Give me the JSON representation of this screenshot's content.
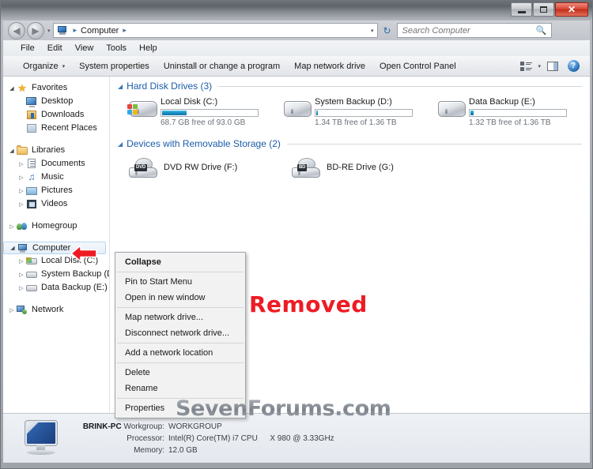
{
  "window": {
    "title": "Computer",
    "buttons": {
      "minimize": "minimize-button",
      "maximize": "maximize-button",
      "close": "✕"
    }
  },
  "address": {
    "crumb_root": "Computer",
    "separator": "▸",
    "dropdown_caret": "▾",
    "refresh_icon": "↻"
  },
  "search": {
    "placeholder": "Search Computer",
    "value": "",
    "icon": "search-icon"
  },
  "menubar": {
    "items": [
      "File",
      "Edit",
      "View",
      "Tools",
      "Help"
    ]
  },
  "toolbar": {
    "organize": "Organize",
    "organize_caret": "▾",
    "items": [
      "System properties",
      "Uninstall or change a program",
      "Map network drive",
      "Open Control Panel"
    ],
    "view_caret": "▾",
    "help_glyph": "?"
  },
  "sidebar": {
    "groups": [
      {
        "label": "Favorites",
        "icon": "star-icon",
        "twisty": "◢",
        "children": [
          {
            "label": "Desktop",
            "icon": "desktop-icon",
            "twisty": ""
          },
          {
            "label": "Downloads",
            "icon": "downloads-icon",
            "twisty": ""
          },
          {
            "label": "Recent Places",
            "icon": "recent-places-icon",
            "twisty": ""
          }
        ]
      },
      {
        "label": "Libraries",
        "icon": "libraries-folder-icon",
        "twisty": "◢",
        "children": [
          {
            "label": "Documents",
            "icon": "documents-icon",
            "twisty": "▷"
          },
          {
            "label": "Music",
            "icon": "music-icon",
            "twisty": "▷"
          },
          {
            "label": "Pictures",
            "icon": "pictures-icon",
            "twisty": "▷"
          },
          {
            "label": "Videos",
            "icon": "videos-icon",
            "twisty": "▷"
          }
        ]
      },
      {
        "label": "Homegroup",
        "icon": "homegroup-icon",
        "twisty": "▷",
        "children": []
      },
      {
        "label": "Computer",
        "icon": "computer-icon",
        "twisty": "◢",
        "selected": true,
        "children": [
          {
            "label": "Local Disk (C:)",
            "icon": "local-disk-icon",
            "twisty": "▷"
          },
          {
            "label": "System Backup (D:)",
            "icon": "hard-disk-icon",
            "twisty": "▷"
          },
          {
            "label": "Data Backup (E:)",
            "icon": "hard-disk-icon",
            "twisty": "▷"
          }
        ]
      },
      {
        "label": "Network",
        "icon": "network-icon",
        "twisty": "▷",
        "children": []
      }
    ]
  },
  "content": {
    "group_hard_disks": {
      "label": "Hard Disk Drives (3)",
      "twisty": "◢",
      "drives": [
        {
          "name": "Local Disk (C:)",
          "free_text": "68.7 GB free of 93.0 GB",
          "used_percent": 26,
          "icon": "windows-drive-icon"
        },
        {
          "name": "System Backup (D:)",
          "free_text": "1.34 TB free of 1.36 TB",
          "used_percent": 2,
          "icon": "hard-drive-icon"
        },
        {
          "name": "Data Backup (E:)",
          "free_text": "1.32 TB free of 1.36 TB",
          "used_percent": 3,
          "icon": "hard-drive-icon"
        }
      ]
    },
    "group_removable": {
      "label": "Devices with Removable Storage (2)",
      "twisty": "◢",
      "devices": [
        {
          "name": "DVD RW Drive (F:)",
          "badge": "DVD",
          "icon": "optical-drive-icon"
        },
        {
          "name": "BD-RE Drive (G:)",
          "badge": "BD",
          "icon": "optical-drive-icon"
        }
      ]
    },
    "annotation": {
      "removed_label": "Removed",
      "removed_color": "#ee1b24"
    },
    "watermark": "SevenForums.com"
  },
  "context_menu": {
    "sections": [
      [
        {
          "label": "Collapse",
          "bold": true
        }
      ],
      [
        {
          "label": "Pin to Start Menu"
        },
        {
          "label": "Open in new window"
        }
      ],
      [
        {
          "label": "Map network drive..."
        },
        {
          "label": "Disconnect network drive..."
        }
      ],
      [
        {
          "label": "Add a network location"
        }
      ],
      [
        {
          "label": "Delete"
        },
        {
          "label": "Rename"
        }
      ],
      [
        {
          "label": "Properties"
        }
      ]
    ]
  },
  "details_pane": {
    "computer_name": "BRINK-PC",
    "rows": [
      {
        "key": "Workgroup:",
        "value": "WORKGROUP"
      },
      {
        "key": "Processor:",
        "value": "Intel(R) Core(TM) i7 CPU",
        "value2": "X 980  @ 3.33GHz"
      },
      {
        "key": "Memory:",
        "value": "12.0 GB"
      }
    ]
  }
}
